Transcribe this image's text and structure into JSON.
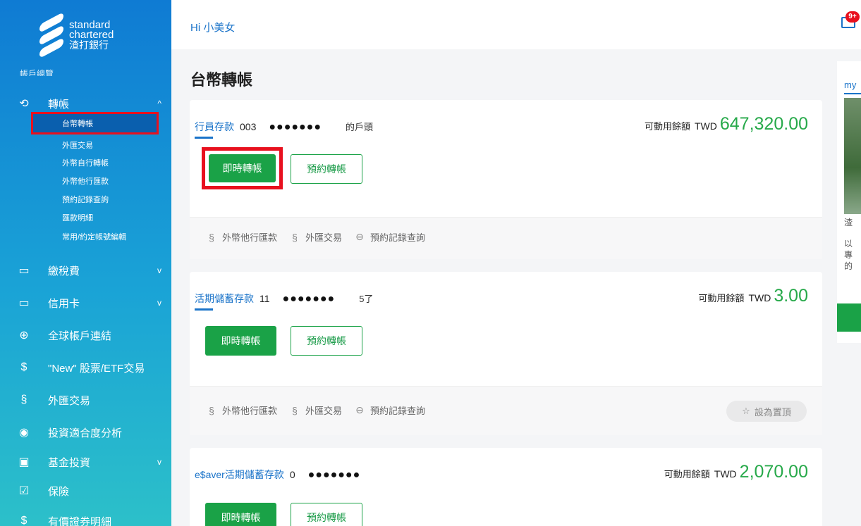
{
  "sidebar": {
    "logo": {
      "line1": "standard",
      "line2": "chartered",
      "line3": "渣打銀行"
    },
    "cut_item": "帳戶總覽",
    "transfer": {
      "label": "轉帳",
      "chevron": "^"
    },
    "sub_items": [
      "台幣轉帳",
      "外匯交易",
      "外幣自行轉帳",
      "外幣他行匯款",
      "預約記錄查詢",
      "匯款明細",
      "常用/約定帳號編輯"
    ],
    "items": [
      {
        "label": "繳稅費",
        "icon": "wallet-icon",
        "chevron": "v"
      },
      {
        "label": "信用卡",
        "icon": "credit-card-icon",
        "chevron": "v"
      },
      {
        "label": "全球帳戶連結",
        "icon": "globe-icon"
      },
      {
        "label": "\"New\" 股票/ETF交易",
        "icon": "stock-icon"
      },
      {
        "label": "外匯交易",
        "icon": "fx-icon"
      },
      {
        "label": "投資適合度分析",
        "icon": "profile-icon"
      },
      {
        "label": "基金投資",
        "icon": "chart-icon",
        "chevron": "v"
      },
      {
        "label": "保險",
        "icon": "insurance-icon"
      },
      {
        "label": "有價證券明細",
        "icon": "securities-icon"
      }
    ]
  },
  "header": {
    "greeting": "Hi 小美女",
    "badge": "9+"
  },
  "page_title": "台幣轉帳",
  "accounts": [
    {
      "type": "行員存款",
      "number": "003",
      "masked": "●●●●●●●",
      "nickname": "的戶頭",
      "balance_label": "可動用餘額",
      "currency": "TWD",
      "balance": "647,320.00"
    },
    {
      "type": "活期儲蓄存款",
      "number": "11",
      "masked": "●●●●●●●",
      "nickname": "5了",
      "balance_label": "可動用餘額",
      "currency": "TWD",
      "balance": "3.00"
    },
    {
      "type": "e$aver活期儲蓄存款",
      "number": "0",
      "masked": "●●●●●●●",
      "nickname": "",
      "balance_label": "可動用餘額",
      "currency": "TWD",
      "balance": "2,070.00"
    }
  ],
  "buttons": {
    "instant": "即時轉帳",
    "scheduled": "預約轉帳",
    "pin": "設為置頂"
  },
  "quick_links": [
    "外幣他行匯款",
    "外匯交易",
    "預約記錄查詢"
  ],
  "right_panel": {
    "tab": "my",
    "t1": "渣",
    "t2": "以",
    "t3": "專",
    "t4": "的"
  }
}
